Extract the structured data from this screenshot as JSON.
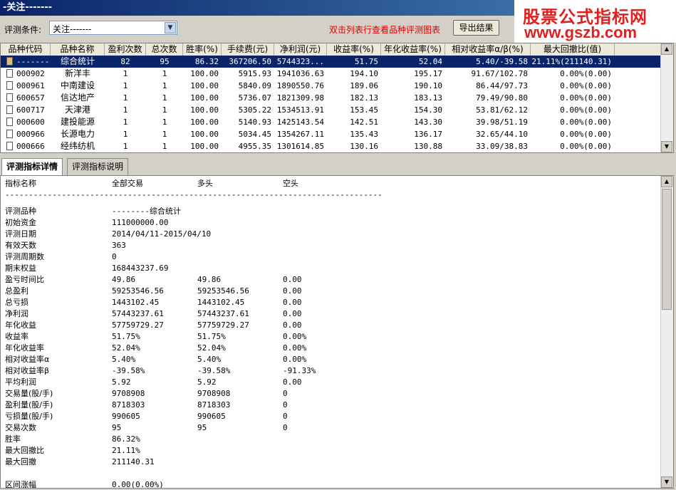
{
  "window": {
    "title": "-关注-------"
  },
  "watermark": {
    "line1": "股票公式指标网",
    "line2": "www.gszb.com"
  },
  "toolbar": {
    "condition_label": "评测条件:",
    "condition_value": "关注-------",
    "hint": "双击列表行查看品种评测图表",
    "export_label": "导出结果"
  },
  "grid": {
    "headers": [
      "品种代码",
      "品种名称",
      "盈利次数",
      "总次数",
      "胜率(%)",
      "手续费(元)",
      "净利润(元)",
      "收益率(%)",
      "年化收益率(%)",
      "相对收益率α/β(%)",
      "最大回撤比(值)"
    ],
    "rows": [
      {
        "code": "-------",
        "name": "综合统计",
        "wins": "82",
        "total": "95",
        "winrate": "86.32",
        "fee": "367206.50",
        "profit": "5744323...",
        "ret": "51.75",
        "annual": "52.04",
        "relative": "5.40/-39.58",
        "drawdown": "21.11%(211140.31)",
        "selected": true
      },
      {
        "code": "000902",
        "name": "新洋丰",
        "wins": "1",
        "total": "1",
        "winrate": "100.00",
        "fee": "5915.93",
        "profit": "1941036.63",
        "ret": "194.10",
        "annual": "195.17",
        "relative": "91.67/102.78",
        "drawdown": "0.00%(0.00)"
      },
      {
        "code": "000961",
        "name": "中南建设",
        "wins": "1",
        "total": "1",
        "winrate": "100.00",
        "fee": "5840.09",
        "profit": "1890550.76",
        "ret": "189.06",
        "annual": "190.10",
        "relative": "86.44/97.73",
        "drawdown": "0.00%(0.00)"
      },
      {
        "code": "600657",
        "name": "信达地产",
        "wins": "1",
        "total": "1",
        "winrate": "100.00",
        "fee": "5736.07",
        "profit": "1821309.98",
        "ret": "182.13",
        "annual": "183.13",
        "relative": "79.49/90.80",
        "drawdown": "0.00%(0.00)"
      },
      {
        "code": "600717",
        "name": "天津港",
        "wins": "1",
        "total": "1",
        "winrate": "100.00",
        "fee": "5305.22",
        "profit": "1534513.91",
        "ret": "153.45",
        "annual": "154.30",
        "relative": "53.81/62.12",
        "drawdown": "0.00%(0.00)"
      },
      {
        "code": "000600",
        "name": "建投能源",
        "wins": "1",
        "total": "1",
        "winrate": "100.00",
        "fee": "5140.93",
        "profit": "1425143.54",
        "ret": "142.51",
        "annual": "143.30",
        "relative": "39.98/51.19",
        "drawdown": "0.00%(0.00)"
      },
      {
        "code": "000966",
        "name": "长源电力",
        "wins": "1",
        "total": "1",
        "winrate": "100.00",
        "fee": "5034.45",
        "profit": "1354267.11",
        "ret": "135.43",
        "annual": "136.17",
        "relative": "32.65/44.10",
        "drawdown": "0.00%(0.00)"
      },
      {
        "code": "000666",
        "name": "经纬纺机",
        "wins": "1",
        "total": "1",
        "winrate": "100.00",
        "fee": "4955.35",
        "profit": "1301614.85",
        "ret": "130.16",
        "annual": "130.88",
        "relative": "33.09/38.83",
        "drawdown": "0.00%(0.00)"
      }
    ]
  },
  "tabs": [
    {
      "label": "评测指标详情",
      "active": true
    },
    {
      "label": "评测指标说明",
      "active": false
    }
  ],
  "detail": {
    "headers": [
      "指标名称",
      "全部交易",
      "多头",
      "空头"
    ],
    "separator": "--------------------------------------------------------------------------------",
    "lines": [
      [
        "",
        "",
        "",
        ""
      ],
      [
        "评测品种",
        "--------综合统计",
        "",
        ""
      ],
      [
        "初始资金",
        "111000000.00",
        "",
        ""
      ],
      [
        "评测日期",
        "2014/04/11-2015/04/10",
        "",
        ""
      ],
      [
        "有效天数",
        "363",
        "",
        ""
      ],
      [
        "评测周期数",
        "0",
        "",
        ""
      ],
      [
        "期末权益",
        "168443237.69",
        "",
        ""
      ],
      [
        "盈亏时间比",
        "49.86",
        "49.86",
        "0.00"
      ],
      [
        "总盈利",
        "59253546.56",
        "59253546.56",
        "0.00"
      ],
      [
        "总亏损",
        "1443102.45",
        "1443102.45",
        "0.00"
      ],
      [
        "净利润",
        "57443237.61",
        "57443237.61",
        "0.00"
      ],
      [
        "年化收益",
        "57759729.27",
        "57759729.27",
        "0.00"
      ],
      [
        "收益率",
        "51.75%",
        "51.75%",
        "0.00%"
      ],
      [
        "年化收益率",
        "52.04%",
        "52.04%",
        "0.00%"
      ],
      [
        "相对收益率α",
        "5.40%",
        " 5.40%",
        " 0.00%"
      ],
      [
        "相对收益率β",
        "-39.58%",
        " -39.58%",
        " -91.33%"
      ],
      [
        "平均利润",
        "5.92",
        "5.92",
        "0.00"
      ],
      [
        "交易量(股/手)",
        "9708908",
        "9708908",
        "0"
      ],
      [
        "盈利量(股/手)",
        "8718303",
        "8718303",
        "0"
      ],
      [
        "亏损量(股/手)",
        "990605",
        "990605",
        "0"
      ],
      [
        "交易次数",
        "95",
        "95",
        "0"
      ],
      [
        "胜率",
        "86.32%",
        "",
        ""
      ],
      [
        "最大回撤比",
        "21.11%",
        "",
        ""
      ],
      [
        "最大回撤",
        "211140.31",
        "",
        ""
      ],
      [
        "",
        "",
        "",
        ""
      ],
      [
        "区间涨幅",
        "0.00(0.00%)",
        "",
        ""
      ]
    ]
  },
  "colors": {
    "title_bg": "#0a246a",
    "selected_row": "#0a246a",
    "hint": "#e00000",
    "watermark": "#e02020"
  },
  "icons": {
    "row_icon": "document-icon",
    "summary_icon": "folder-icon",
    "dropdown": "chevron-down-icon"
  }
}
